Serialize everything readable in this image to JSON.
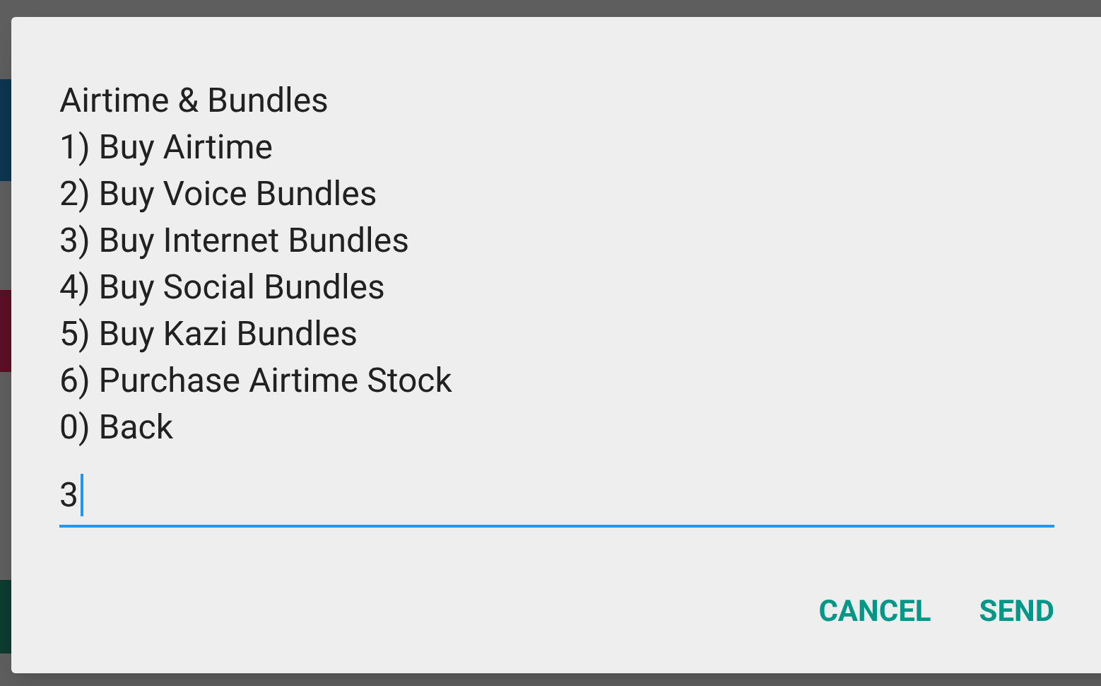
{
  "dialog": {
    "message_lines": [
      "Airtime & Bundles",
      "1) Buy Airtime",
      "2) Buy Voice Bundles",
      "3) Buy Internet Bundles",
      "4) Buy Social Bundles",
      "5) Buy Kazi Bundles",
      "6) Purchase Airtime Stock",
      "0) Back"
    ],
    "input": {
      "value": "3"
    },
    "buttons": [
      {
        "label": "CANCEL"
      },
      {
        "label": "SEND"
      }
    ]
  }
}
